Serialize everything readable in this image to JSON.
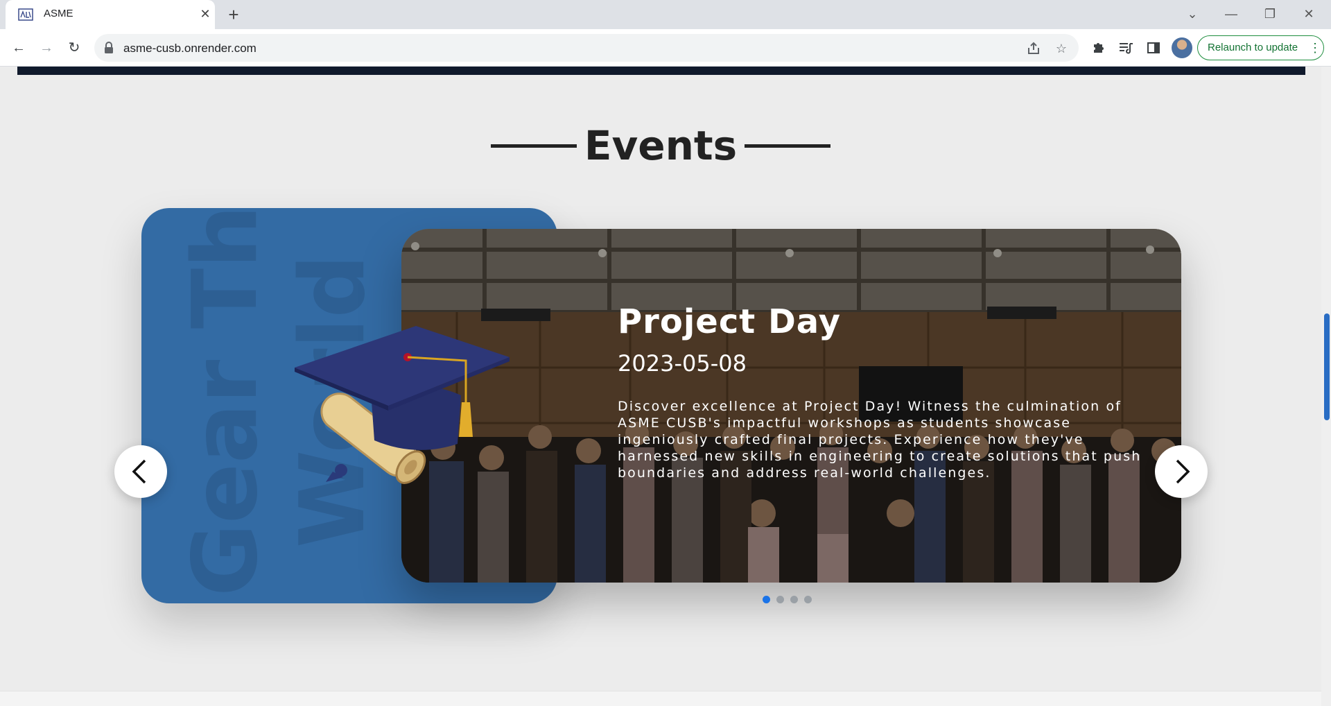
{
  "browser": {
    "tab_title": "ASME",
    "tab_close_icon": "close-icon",
    "new_tab_icon": "plus-icon",
    "url": "asme-cusb.onrender.com",
    "relaunch_label": "Relaunch to update",
    "icons": [
      "back-icon",
      "forward-icon",
      "reload-icon",
      "lock-icon",
      "share-icon",
      "star-icon",
      "extensions-icon",
      "media-icon",
      "side-panel-icon",
      "kebab-menu-icon"
    ]
  },
  "section": {
    "heading": "Events"
  },
  "carousel": {
    "background_text_line1": "Gear The",
    "background_text_line2": "World",
    "slide": {
      "title": "Project Day",
      "date": "2023-05-08",
      "description": "Discover excellence at Project Day! Witness the culmination of ASME CUSB's impactful workshops as students showcase ingeniously crafted final projects. Experience how they've harnessed new skills in engineering to create solutions that push boundaries and address real-world challenges."
    },
    "dot_count": 4,
    "active_dot": 0,
    "colors": {
      "card": "#336ba4",
      "active_dot": "#1a73e8",
      "inactive_dot": "#9aa0a6"
    }
  }
}
